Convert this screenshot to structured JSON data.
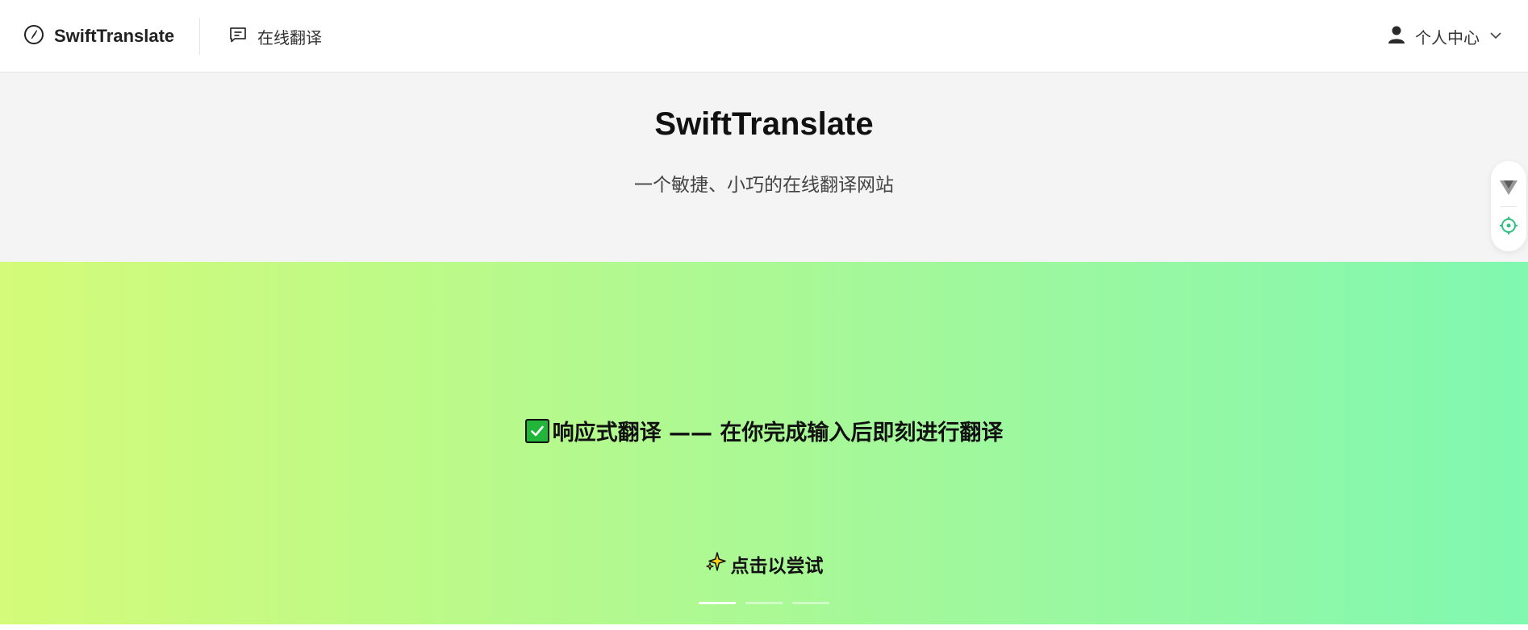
{
  "nav": {
    "brand": "SwiftTranslate",
    "brand_icon": "compass-icon",
    "item_online_translate": "在线翻译",
    "item_icon": "message-square-icon",
    "user_menu_label": "个人中心",
    "user_icon": "user-icon",
    "user_chevron": "chevron-down-icon"
  },
  "hero": {
    "title": "SwiftTranslate",
    "subtitle": "一个敏捷、小巧的在线翻译网站"
  },
  "side_widget": {
    "top_icon": "triangle-down-logo-icon",
    "bottom_icon": "crosshair-target-icon",
    "accent": "#2ec27e"
  },
  "carousel": {
    "slide_text": "响应式翻译 —— 在你完成输入后即刻进行翻译",
    "slide_icon": "check-mark-button-icon",
    "try_label": "点击以尝试",
    "try_icon": "sparkles-icon",
    "slides_total": 3,
    "active_slide": 1,
    "gradient": [
      "#d4fb79",
      "#80f8b0"
    ]
  }
}
